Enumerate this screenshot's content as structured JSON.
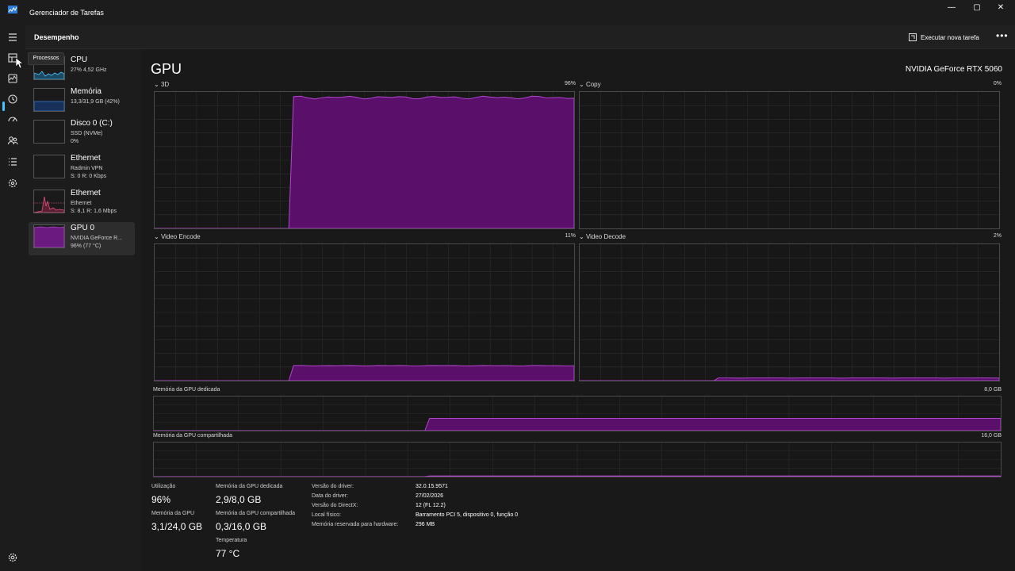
{
  "window": {
    "title": "Gerenciador de Tarefas",
    "controls": {
      "minimize": "—",
      "maximize": "▢",
      "close": "✕"
    }
  },
  "navrail": {
    "items": [
      {
        "icon": "hamburger-menu-icon"
      },
      {
        "icon": "processes-icon",
        "tooltip": "Processos"
      },
      {
        "icon": "performance-icon",
        "active": true
      },
      {
        "icon": "app-history-icon"
      },
      {
        "icon": "startup-apps-icon"
      },
      {
        "icon": "users-icon"
      },
      {
        "icon": "details-icon"
      },
      {
        "icon": "services-icon"
      },
      {
        "icon": "settings-icon"
      }
    ]
  },
  "header": {
    "title": "Desempenho",
    "run_task_label": "Executar nova tarefa",
    "more_label": "•••"
  },
  "devices": [
    {
      "name": "CPU",
      "sub1": "27% 4,52 GHz",
      "sub2": "",
      "color": "#4cc2ff"
    },
    {
      "name": "Memória",
      "sub1": "13,3/31,9 GB (42%)",
      "sub2": "",
      "color": "#3a7bd5"
    },
    {
      "name": "Disco 0 (C:)",
      "sub1": "SSD (NVMe)",
      "sub2": "0%",
      "color": "#7cc44e"
    },
    {
      "name": "Ethernet",
      "sub1": "Radmin VPN",
      "sub2": "S: 0 R: 0 Kbps",
      "color": "#d4a05a"
    },
    {
      "name": "Ethernet",
      "sub1": "Ethernet",
      "sub2": "S: 8,1 R: 1,6 Mbps",
      "color": "#e0507a"
    },
    {
      "name": "GPU 0",
      "sub1": "NVIDIA GeForce R...",
      "sub2": "96% (77 °C)",
      "color": "#9b30b5",
      "selected": true
    }
  ],
  "main": {
    "title": "GPU",
    "model": "NVIDIA GeForce RTX 5060",
    "accent_color": "#800080",
    "graphs": {
      "g3d": {
        "label": "3D",
        "pct": "96%",
        "level": 0.96
      },
      "copy": {
        "label": "Copy",
        "pct": "0%",
        "level": 0
      },
      "encode": {
        "label": "Video Encode",
        "pct": "11%",
        "level": 0.11
      },
      "decode": {
        "label": "Video Decode",
        "pct": "2%",
        "level": 0.02
      },
      "dedicated": {
        "label": "Memória da GPU dedicada",
        "max": "8,0 GB",
        "level": 0.36
      },
      "shared": {
        "label": "Memória da GPU compartilhada",
        "max": "16,0 GB",
        "level": 0.02
      }
    },
    "stats": {
      "utilization_label": "Utilização",
      "utilization_value": "96%",
      "dedicated_label": "Memória da GPU dedicada",
      "dedicated_value": "2,9/8,0 GB",
      "gpu_mem_label": "Memória da GPU",
      "gpu_mem_value": "3,1/24,0 GB",
      "shared_label": "Memória da GPU compartilhada",
      "shared_value": "0,3/16,0 GB",
      "temp_label": "Temperatura",
      "temp_value": "77 °C"
    },
    "info": [
      {
        "label": "Versão do driver:",
        "value": "32.0.15.9571"
      },
      {
        "label": "Data do driver:",
        "value": "27/02/2026"
      },
      {
        "label": "Versão do DirectX:",
        "value": "12 (FL 12.2)"
      },
      {
        "label": "Local físico:",
        "value": "Barramento PCI 5, dispositivo 0, função 0"
      },
      {
        "label": "Memória reservada para hardware:",
        "value": "296 MB"
      }
    ]
  }
}
